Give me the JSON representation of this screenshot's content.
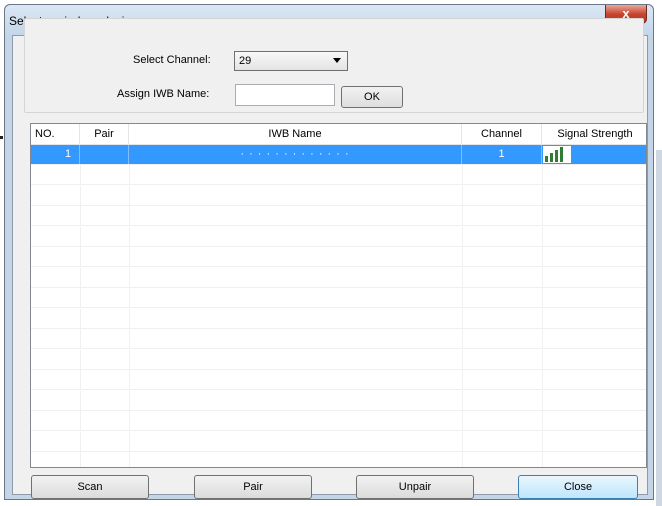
{
  "window": {
    "title": "Select a wireless device",
    "close_label": "x"
  },
  "form": {
    "channel_label": "Select Channel:",
    "channel_value": "29",
    "name_label": "Assign IWB Name:",
    "name_value": "",
    "ok_label": "OK"
  },
  "table": {
    "columns": [
      "NO.",
      "Pair",
      "IWB Name",
      "Channel",
      "Signal Strength"
    ],
    "rows": [
      {
        "no": "1",
        "pair": "",
        "name": "· · · · · · · · · · · · ·",
        "channel": "1",
        "signal_bars": 4,
        "selected": true
      }
    ],
    "selection_color": "#3399ff",
    "signal_color": "#2e7d32"
  },
  "buttons": {
    "scan": "Scan",
    "pair": "Pair",
    "unpair": "Unpair",
    "close": "Close"
  }
}
